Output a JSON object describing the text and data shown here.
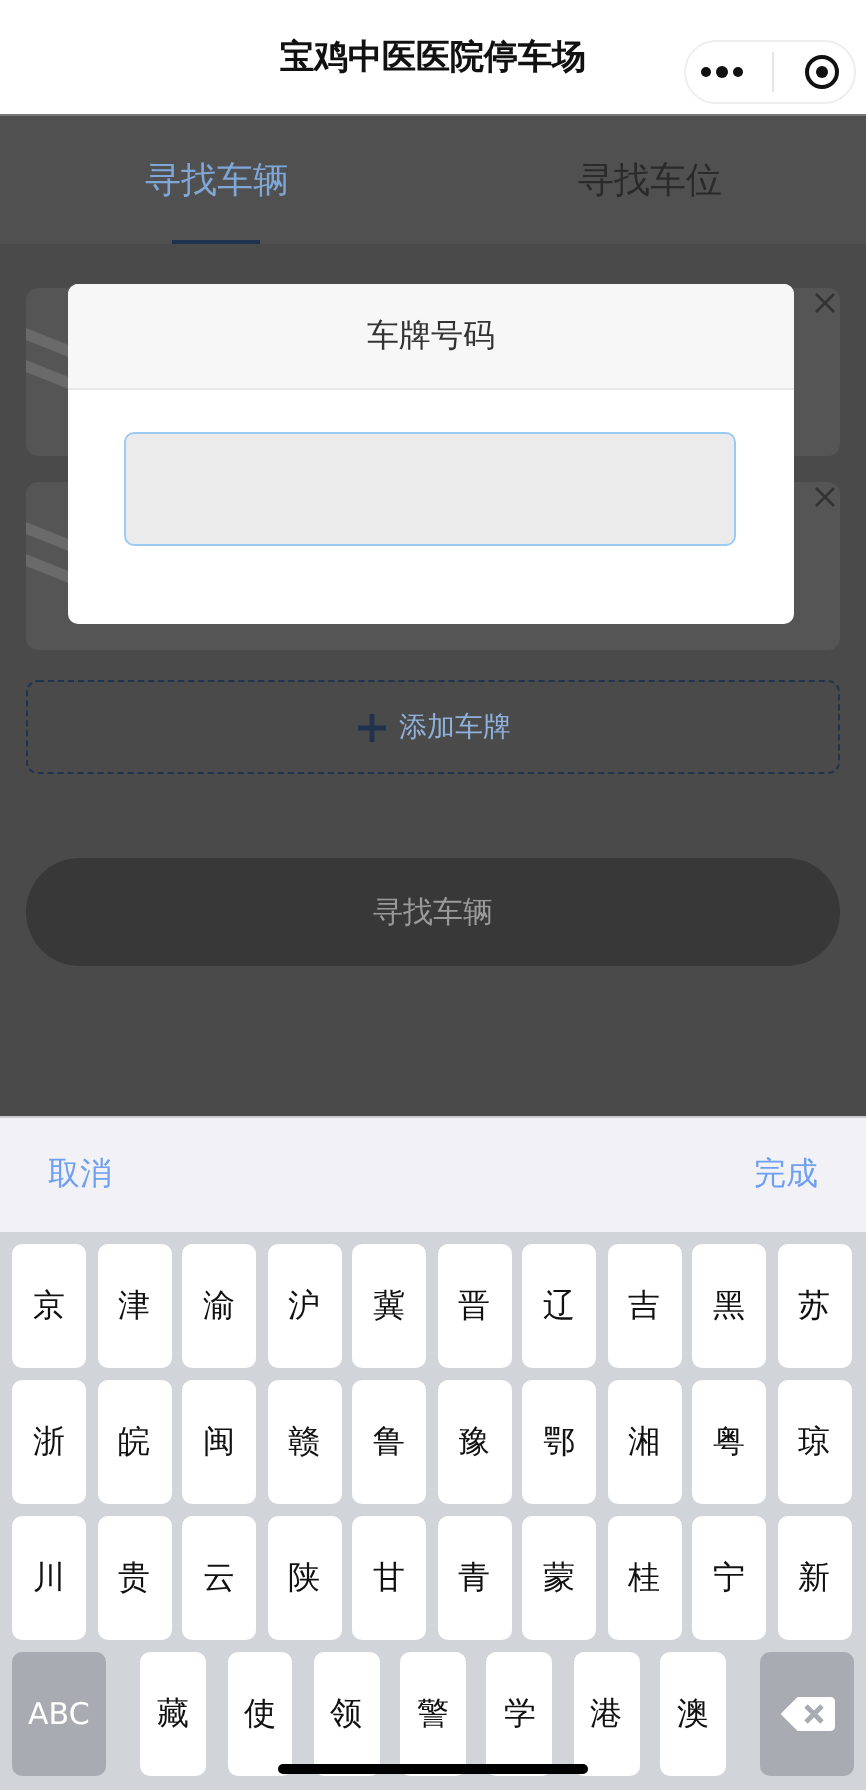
{
  "header": {
    "title": "宝鸡中医医院停车场"
  },
  "tabs": [
    {
      "label": "寻找车辆",
      "selected": true
    },
    {
      "label": "寻找车位",
      "selected": false
    }
  ],
  "plate_cards": [
    {
      "closable": true
    },
    {
      "closable": true
    }
  ],
  "add_plate": {
    "label": "添加车牌"
  },
  "search_button": {
    "label": "寻找车辆"
  },
  "dialog": {
    "title": "车牌号码",
    "field": {
      "focused": true
    }
  },
  "keyboard_toolbar": {
    "cancel": "取消",
    "done": "完成"
  },
  "keyboard": {
    "rows": [
      [
        {
          "kind": "char",
          "label": "京"
        },
        {
          "kind": "char",
          "label": "津"
        },
        {
          "kind": "char",
          "label": "渝"
        },
        {
          "kind": "char",
          "label": "沪"
        },
        {
          "kind": "char",
          "label": "冀"
        },
        {
          "kind": "char",
          "label": "晋"
        },
        {
          "kind": "char",
          "label": "辽"
        },
        {
          "kind": "char",
          "label": "吉"
        },
        {
          "kind": "char",
          "label": "黑"
        },
        {
          "kind": "char",
          "label": "苏"
        }
      ],
      [
        {
          "kind": "char",
          "label": "浙"
        },
        {
          "kind": "char",
          "label": "皖"
        },
        {
          "kind": "char",
          "label": "闽"
        },
        {
          "kind": "char",
          "label": "赣"
        },
        {
          "kind": "char",
          "label": "鲁"
        },
        {
          "kind": "char",
          "label": "豫"
        },
        {
          "kind": "char",
          "label": "鄂"
        },
        {
          "kind": "char",
          "label": "湘"
        },
        {
          "kind": "char",
          "label": "粤"
        },
        {
          "kind": "char",
          "label": "琼"
        }
      ],
      [
        {
          "kind": "char",
          "label": "川"
        },
        {
          "kind": "char",
          "label": "贵"
        },
        {
          "kind": "char",
          "label": "云"
        },
        {
          "kind": "char",
          "label": "陕"
        },
        {
          "kind": "char",
          "label": "甘"
        },
        {
          "kind": "char",
          "label": "青"
        },
        {
          "kind": "char",
          "label": "蒙"
        },
        {
          "kind": "char",
          "label": "桂"
        },
        {
          "kind": "char",
          "label": "宁"
        },
        {
          "kind": "char",
          "label": "新"
        }
      ],
      [
        {
          "kind": "mode",
          "label": "ABC"
        },
        {
          "kind": "char",
          "label": "藏"
        },
        {
          "kind": "char",
          "label": "使"
        },
        {
          "kind": "char",
          "label": "领"
        },
        {
          "kind": "char",
          "label": "警"
        },
        {
          "kind": "char",
          "label": "学"
        },
        {
          "kind": "char",
          "label": "港"
        },
        {
          "kind": "char",
          "label": "澳"
        },
        {
          "kind": "backspace"
        }
      ]
    ]
  }
}
